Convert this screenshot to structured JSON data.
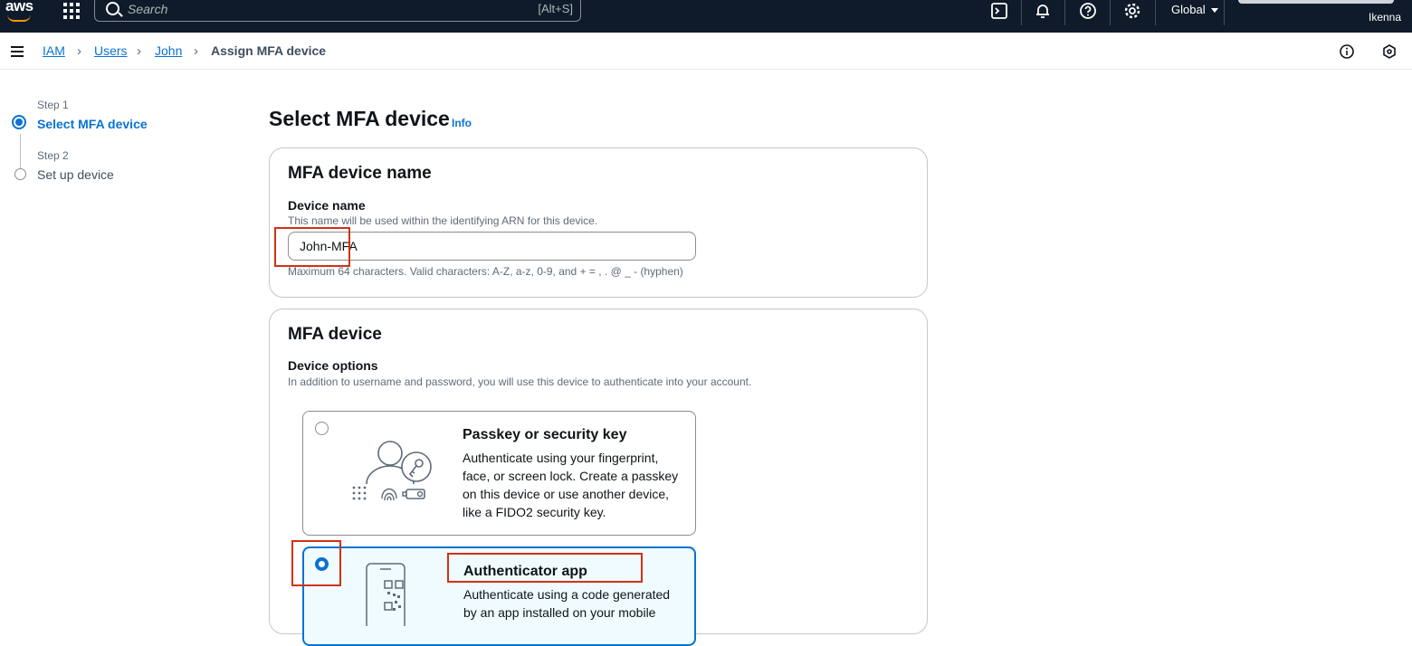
{
  "nav": {
    "logo": "aws",
    "search_placeholder": "Search",
    "search_shortcut": "[Alt+S]",
    "region": "Global",
    "user": "Ikenna"
  },
  "breadcrumb": [
    "IAM",
    "Users",
    "John",
    "Assign MFA device"
  ],
  "steps": [
    {
      "label": "Step 1",
      "name": "Select MFA device"
    },
    {
      "label": "Step 2",
      "name": "Set up device"
    }
  ],
  "page": {
    "title": "Select MFA device",
    "info": "Info"
  },
  "name_panel": {
    "heading": "MFA device name",
    "field_label": "Device name",
    "field_desc": "This name will be used within the identifying ARN for this device.",
    "value": "John-MFA",
    "constraint": "Maximum 64 characters. Valid characters: A-Z, a-z, 0-9, and + = , . @ _ - (hyphen)"
  },
  "device_panel": {
    "heading": "MFA device",
    "options_label": "Device options",
    "options_desc": "In addition to username and password, you will use this device to authenticate into your account.",
    "options": [
      {
        "title": "Passkey or security key",
        "desc": "Authenticate using your fingerprint, face, or screen lock. Create a passkey on this device or use another device, like a FIDO2 security key.",
        "selected": false
      },
      {
        "title": "Authenticator app",
        "desc": "Authenticate using a code generated by an app installed on your mobile",
        "selected": true
      }
    ]
  },
  "colors": {
    "accent": "#0972d3",
    "nav_bg": "#0f1b2a",
    "highlight": "#d13212"
  }
}
